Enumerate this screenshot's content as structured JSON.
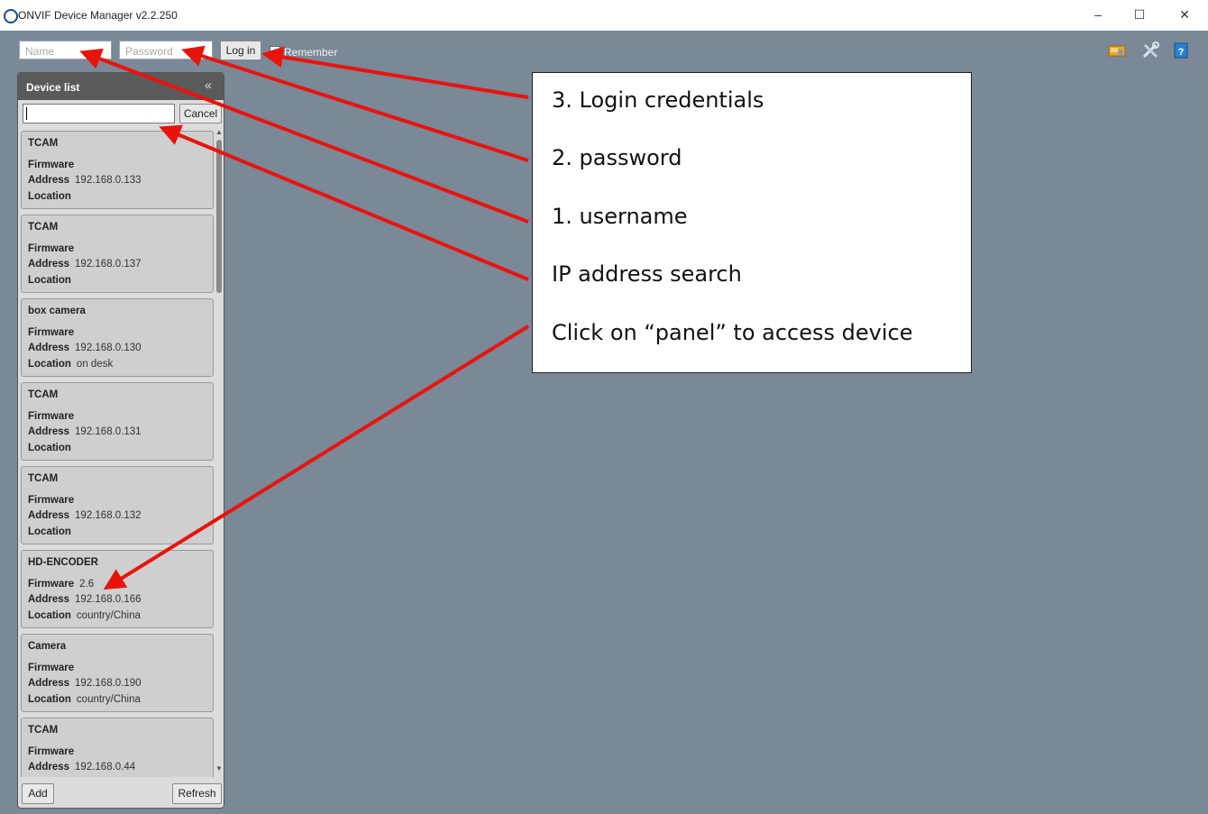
{
  "window": {
    "title": "ONVIF Device Manager v2.2.250",
    "controls": {
      "minimize": "–",
      "maximize": "☐",
      "close": "✕"
    }
  },
  "login": {
    "name_placeholder": "Name",
    "password_placeholder": "Password",
    "login_label": "Log in",
    "remember_label": "Remember",
    "remember_checked": true
  },
  "toolbar_icons": [
    "network-icon",
    "settings-tools-icon",
    "help-book-icon"
  ],
  "device_list": {
    "title": "Device list",
    "collapse_glyph": "«",
    "search_value": "",
    "cancel_label": "Cancel",
    "labels": {
      "firmware": "Firmware",
      "address": "Address",
      "location": "Location"
    },
    "devices": [
      {
        "name": "TCAM",
        "firmware": "",
        "address": "192.168.0.133",
        "location": ""
      },
      {
        "name": "TCAM",
        "firmware": "",
        "address": "192.168.0.137",
        "location": ""
      },
      {
        "name": "box camera",
        "firmware": "",
        "address": "192.168.0.130",
        "location": "on desk"
      },
      {
        "name": "TCAM",
        "firmware": "",
        "address": "192.168.0.131",
        "location": ""
      },
      {
        "name": "TCAM",
        "firmware": "",
        "address": "192.168.0.132",
        "location": ""
      },
      {
        "name": "HD-ENCODER",
        "firmware": "2.6",
        "address": "192.168.0.166",
        "location": "country/China"
      },
      {
        "name": "Camera",
        "firmware": "",
        "address": "192.168.0.190",
        "location": "country/China"
      },
      {
        "name": "TCAM",
        "firmware": "",
        "address": "192.168.0.44",
        "location": ""
      }
    ],
    "add_label": "Add",
    "refresh_label": "Refresh"
  },
  "annotations": {
    "login_credentials": "3. Login credentials",
    "password": "2. password",
    "username": "1. username",
    "ip_search": "IP address search",
    "panel_access": "Click on “panel” to access device",
    "arrow_color": "#e8140c"
  },
  "colors": {
    "workspace_bg": "#7a8898",
    "panel_header": "#5a5a5a",
    "card_bg": "#cfcfcf"
  }
}
